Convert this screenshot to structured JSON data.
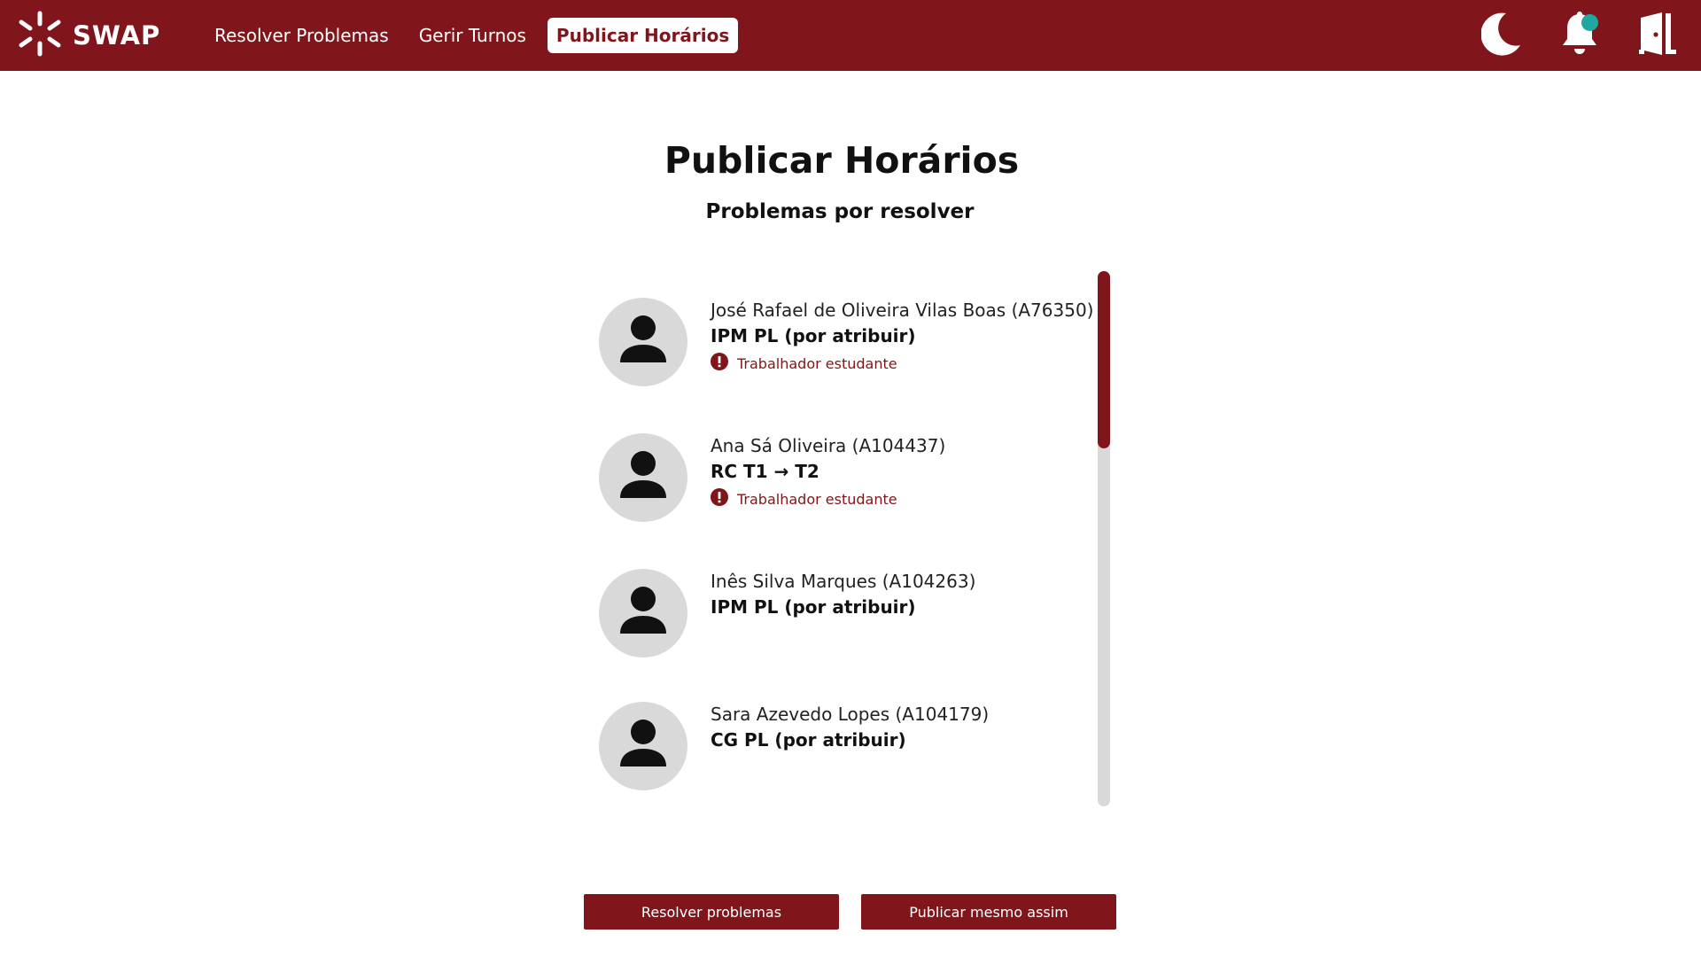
{
  "header": {
    "brand": "SWAP",
    "nav": [
      {
        "label": "Resolver Problemas",
        "active": false
      },
      {
        "label": "Gerir Turnos",
        "active": false
      },
      {
        "label": "Publicar Horários",
        "active": true
      }
    ],
    "icons": [
      "moon-icon",
      "bell-icon",
      "logout-door-icon"
    ],
    "notification_dot_color": "#1fa7a0"
  },
  "main": {
    "title": "Publicar Horários",
    "subtitle": "Problemas por resolver",
    "problems": [
      {
        "name": "José Rafael de Oliveira Vilas Boas (A76350)",
        "detail": "IPM PL (por atribuir)",
        "warning": "Trabalhador estudante"
      },
      {
        "name": "Ana Sá Oliveira (A104437)",
        "detail": "RC T1 → T2",
        "warning": "Trabalhador estudante"
      },
      {
        "name": "Inês Silva Marques (A104263)",
        "detail": "IPM PL (por atribuir)",
        "warning": null
      },
      {
        "name": "Sara Azevedo Lopes (A104179)",
        "detail": "CG PL (por atribuir)",
        "warning": null
      }
    ]
  },
  "actions": {
    "resolve_label": "Resolver problemas",
    "publish_label": "Publicar mesmo assim"
  },
  "colors": {
    "brand": "#80161b",
    "avatar_bg": "#d9d9d9",
    "scroll_track": "#d9d9d9"
  }
}
